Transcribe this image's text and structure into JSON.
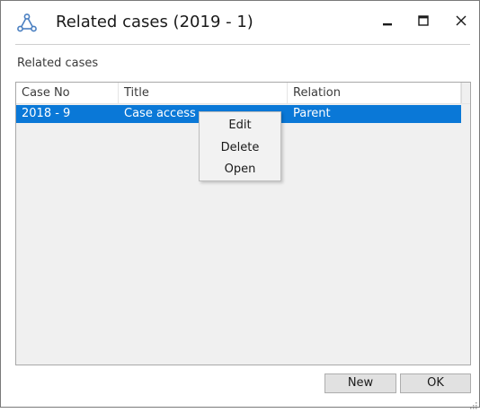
{
  "window": {
    "title": "Related cases (2019 - 1)",
    "icon": "relations-icon"
  },
  "controls": {
    "minimize": "minimize-icon",
    "maximize": "maximize-icon",
    "close": "close-icon"
  },
  "section": {
    "label": "Related cases"
  },
  "table": {
    "columns": [
      "Case No",
      "Title",
      "Relation"
    ],
    "rows": [
      {
        "case_no": "2018 - 9",
        "title": "Case access",
        "relation": "Parent",
        "selected": true
      }
    ]
  },
  "context_menu": {
    "items": [
      "Edit",
      "Delete",
      "Open"
    ]
  },
  "buttons": {
    "new": "New",
    "ok": "OK"
  },
  "colors": {
    "selection": "#0a78d7",
    "list_background": "#f0f0f0"
  }
}
